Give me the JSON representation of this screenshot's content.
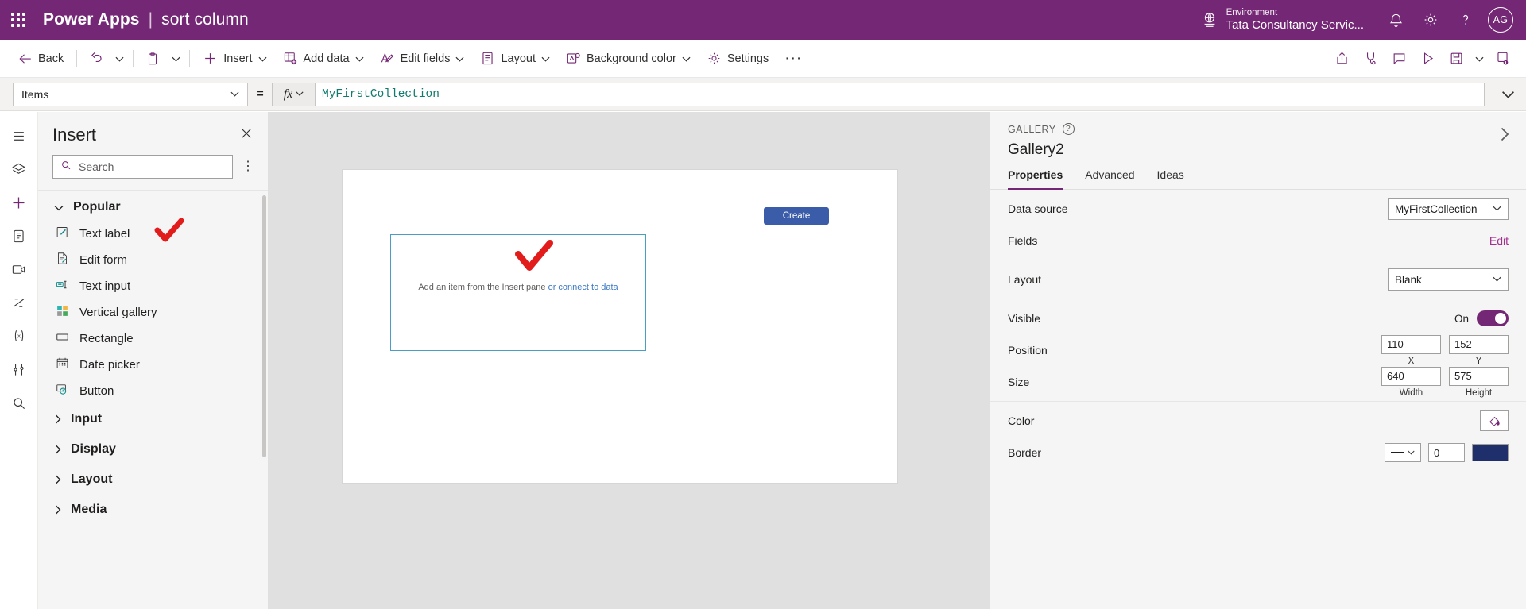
{
  "topbar": {
    "waffle_icon": "waffle-grid-icon",
    "brand": "Power Apps",
    "separator": "|",
    "app_name": "sort column",
    "environment_label": "Environment",
    "environment_name": "Tata Consultancy Servic...",
    "globe_icon": "environment-globe-icon",
    "bell_icon": "notifications-bell-icon",
    "gear_icon": "settings-gear-icon",
    "help_icon": "help-question-icon",
    "avatar_initials": "AG"
  },
  "ribbon": {
    "back_label": "Back",
    "back_icon": "arrow-left-icon",
    "undo_icon": "undo-arrow-icon",
    "paste_icon": "clipboard-paste-icon",
    "items": [
      {
        "label": "Insert",
        "icon": "plus-icon",
        "caret": true
      },
      {
        "label": "Add data",
        "icon": "add-data-icon",
        "caret": true
      },
      {
        "label": "Edit fields",
        "icon": "edit-fields-icon",
        "caret": true
      },
      {
        "label": "Layout",
        "icon": "layout-icon",
        "caret": true
      },
      {
        "label": "Background color",
        "icon": "background-color-icon",
        "caret": true
      },
      {
        "label": "Settings",
        "icon": "settings-gear-icon",
        "caret": false
      }
    ],
    "overflow": "···",
    "right_icons": [
      "share-icon",
      "check-app-icon",
      "comments-icon",
      "preview-play-icon",
      "save-icon",
      "publish-icon"
    ]
  },
  "formula_bar": {
    "property": "Items",
    "equals": "=",
    "fx_label": "fx",
    "formula": "MyFirstCollection",
    "expand_icon": "chevron-down-icon"
  },
  "rail": {
    "items": [
      "tree-view-icon",
      "insert-layers-icon",
      "insert-plus-icon",
      "data-icon",
      "media-icon",
      "power-automate-icon",
      "variables-icon",
      "tools-icon",
      "search-icon"
    ]
  },
  "insert_panel": {
    "title": "Insert",
    "close_icon": "close-icon",
    "search_placeholder": "Search",
    "search_value": "",
    "search_icon": "search-icon",
    "more_icon": "more-vertical-icon",
    "sections": [
      {
        "label": "Popular",
        "expanded": true,
        "items": [
          {
            "label": "Text label",
            "icon": "text-label-icon",
            "annotated": true
          },
          {
            "label": "Edit form",
            "icon": "edit-form-icon",
            "annotated": false
          },
          {
            "label": "Text input",
            "icon": "text-input-icon",
            "annotated": false
          },
          {
            "label": "Vertical gallery",
            "icon": "vertical-gallery-icon",
            "annotated": false
          },
          {
            "label": "Rectangle",
            "icon": "rectangle-icon",
            "annotated": false
          },
          {
            "label": "Date picker",
            "icon": "date-picker-icon",
            "annotated": false
          },
          {
            "label": "Button",
            "icon": "button-icon",
            "annotated": false
          }
        ]
      },
      {
        "label": "Input",
        "expanded": false,
        "items": []
      },
      {
        "label": "Display",
        "expanded": false,
        "items": []
      },
      {
        "label": "Layout",
        "expanded": false,
        "items": []
      },
      {
        "label": "Media",
        "expanded": false,
        "items": []
      }
    ]
  },
  "canvas": {
    "create_button": "Create",
    "gallery_hint_prefix": "Add an item from the Insert pane",
    "gallery_hint_link": "or connect to data",
    "annotation": "red-check-mark"
  },
  "properties_panel": {
    "kicker": "GALLERY",
    "help_icon": "help-question-icon",
    "collapse_icon": "chevron-right-icon",
    "control_name": "Gallery2",
    "tabs": [
      {
        "label": "Properties",
        "active": true
      },
      {
        "label": "Advanced",
        "active": false
      },
      {
        "label": "Ideas",
        "active": false
      }
    ],
    "rows": {
      "data_source_label": "Data source",
      "data_source_value": "MyFirstCollection",
      "fields_label": "Fields",
      "fields_action": "Edit",
      "layout_label": "Layout",
      "layout_value": "Blank",
      "visible_label": "Visible",
      "visible_state": "On",
      "position_label": "Position",
      "position_x": "110",
      "position_y": "152",
      "position_x_caption": "X",
      "position_y_caption": "Y",
      "size_label": "Size",
      "size_width": "640",
      "size_height": "575",
      "size_width_caption": "Width",
      "size_height_caption": "Height",
      "color_label": "Color",
      "color_icon": "fill-color-icon",
      "border_label": "Border",
      "border_width": "0",
      "border_color_hex": "#1f2f6b"
    }
  },
  "colors": {
    "brand_purple": "#742774",
    "accent_teal": "#0f7b6c",
    "selection_blue": "#4a9ec4",
    "annotation_red": "#e21b1b",
    "create_button_blue": "#3b5ca8"
  }
}
